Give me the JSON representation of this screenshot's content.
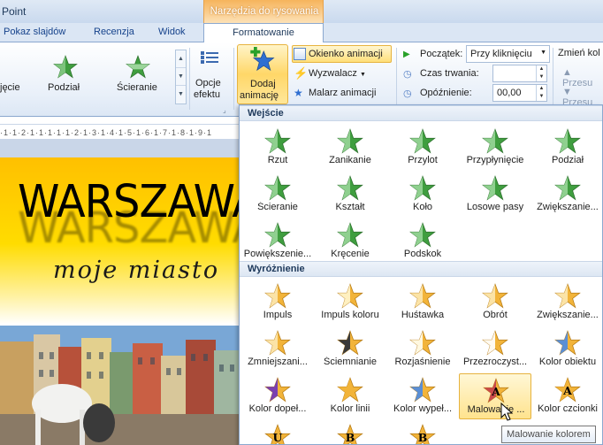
{
  "window": {
    "app_title": "Point"
  },
  "context_tab": {
    "group_title": "Narzędzia do rysowania",
    "tab_label": "Formatowanie"
  },
  "tabs": [
    "Pokaz slajdów",
    "Recenzja",
    "Widok"
  ],
  "ribbon": {
    "gallery_labels": [
      "jęcie",
      "Podział",
      "Ścieranie"
    ],
    "opcje_label_1": "Opcje",
    "opcje_label_2": "efektu",
    "dodaj_label_1": "Dodaj",
    "dodaj_label_2": "animację",
    "okienko": "Okienko animacji",
    "wyzwalacz": "Wyzwalacz",
    "malarz": "Malarz animacji",
    "poczatek_label": "Początek:",
    "poczatek_value": "Przy kliknięciu",
    "czas_label": "Czas trwania:",
    "czas_value": "",
    "opoznienie_label": "Opóźnienie:",
    "opoznienie_value": "00,00",
    "zmien_label": "Zmień kol",
    "przesun_1": "Przesu",
    "przesun_2": "Przesu"
  },
  "ruler": {
    "text": "·1·1·2·1·1·1·1·1·2·1·3·1·4·1·5·1·6·1·7·1·8·1·9·1"
  },
  "slide": {
    "title": "WARSZAWA",
    "subtitle": "moje miasto"
  },
  "gallery": {
    "section_entrance": "Wejście",
    "section_emphasis": "Wyróżnienie",
    "entrance": [
      "Rzut",
      "Zanikanie",
      "Przylot",
      "Przypłynięcie",
      "Podział",
      "Ścieranie",
      "Kształt",
      "Koło",
      "Losowe pasy",
      "Zwiększanie...",
      "Powiększenie...",
      "Kręcenie",
      "Podskok"
    ],
    "emphasis": [
      "Impuls",
      "Impuls koloru",
      "Huśtawka",
      "Obrót",
      "Zwiększanie...",
      "Zmniejszani...",
      "Ściemnianie",
      "Rozjaśnienie",
      "Przezroczyst...",
      "Kolor obiektu",
      "Kolor dopeł...",
      "Kolor linii",
      "Kolor wypeł...",
      "Malowanie ...",
      "Kolor czcionki"
    ],
    "emphasis_row4_letters": [
      "U",
      "B",
      "B"
    ]
  },
  "tooltip": "Malowanie kolorem",
  "colors": {
    "entrance_star": "#3f9e3f",
    "emphasis_star": "#f2b43a",
    "selection": "#ffe38e",
    "ribbon_border": "#8ba8cf"
  },
  "icons": [
    "star-icon",
    "add-animation-icon",
    "animation-pane-icon",
    "trigger-icon",
    "animation-painter-icon",
    "play-icon",
    "clock-icon",
    "cursor-icon"
  ]
}
